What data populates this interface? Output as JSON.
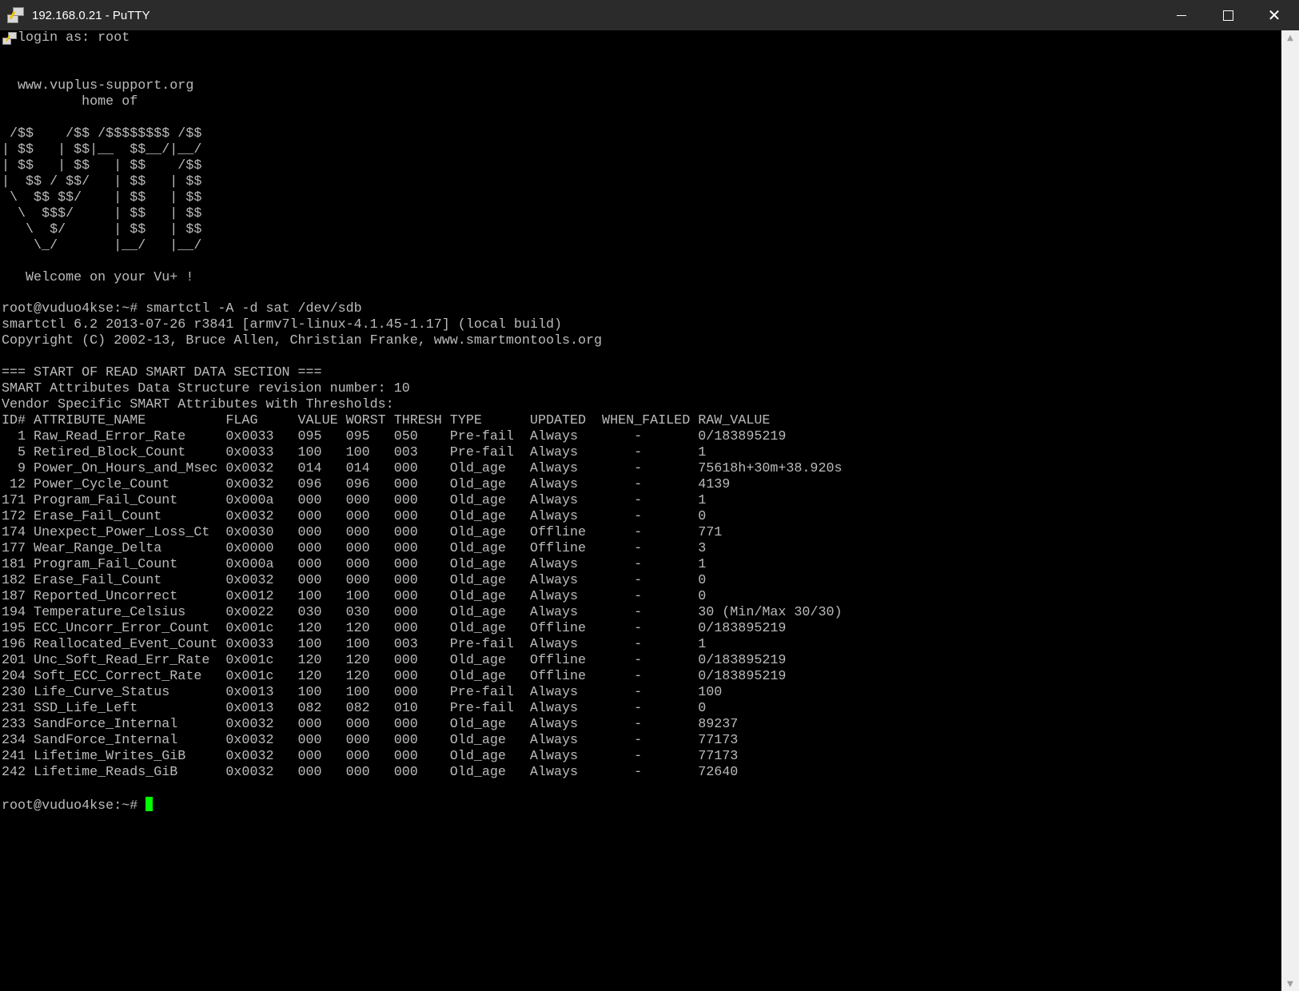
{
  "window": {
    "title": "192.168.0.21 - PuTTY",
    "app_icon": "putty-icon",
    "controls": {
      "minimize_icon": "minimize-icon",
      "maximize_icon": "maximize-icon",
      "close_label": "✕"
    }
  },
  "terminal": {
    "lines": [
      "  login as: root",
      "",
      "",
      "  www.vuplus-support.org",
      "          home of",
      "",
      " /$$    /$$ /$$$$$$$$ /$$",
      "| $$   | $$|__  $$__/|__/",
      "| $$   | $$   | $$    /$$",
      "|  $$ / $$/   | $$   | $$",
      " \\  $$ $$/    | $$   | $$",
      "  \\  $$$/     | $$   | $$",
      "   \\  $/      | $$   | $$",
      "    \\_/       |__/   |__/",
      "",
      "   Welcome on your Vu+ !",
      "",
      "root@vuduo4kse:~# smartctl -A -d sat /dev/sdb",
      "smartctl 6.2 2013-07-26 r3841 [armv7l-linux-4.1.45-1.17] (local build)",
      "Copyright (C) 2002-13, Bruce Allen, Christian Franke, www.smartmontools.org",
      "",
      "=== START OF READ SMART DATA SECTION ===",
      "SMART Attributes Data Structure revision number: 10",
      "Vendor Specific SMART Attributes with Thresholds:",
      "ID# ATTRIBUTE_NAME          FLAG     VALUE WORST THRESH TYPE      UPDATED  WHEN_FAILED RAW_VALUE",
      "  1 Raw_Read_Error_Rate     0x0033   095   095   050    Pre-fail  Always       -       0/183895219",
      "  5 Retired_Block_Count     0x0033   100   100   003    Pre-fail  Always       -       1",
      "  9 Power_On_Hours_and_Msec 0x0032   014   014   000    Old_age   Always       -       75618h+30m+38.920s",
      " 12 Power_Cycle_Count       0x0032   096   096   000    Old_age   Always       -       4139",
      "171 Program_Fail_Count      0x000a   000   000   000    Old_age   Always       -       1",
      "172 Erase_Fail_Count        0x0032   000   000   000    Old_age   Always       -       0",
      "174 Unexpect_Power_Loss_Ct  0x0030   000   000   000    Old_age   Offline      -       771",
      "177 Wear_Range_Delta        0x0000   000   000   000    Old_age   Offline      -       3",
      "181 Program_Fail_Count      0x000a   000   000   000    Old_age   Always       -       1",
      "182 Erase_Fail_Count        0x0032   000   000   000    Old_age   Always       -       0",
      "187 Reported_Uncorrect      0x0012   100   100   000    Old_age   Always       -       0",
      "194 Temperature_Celsius     0x0022   030   030   000    Old_age   Always       -       30 (Min/Max 30/30)",
      "195 ECC_Uncorr_Error_Count  0x001c   120   120   000    Old_age   Offline      -       0/183895219",
      "196 Reallocated_Event_Count 0x0033   100   100   003    Pre-fail  Always       -       1",
      "201 Unc_Soft_Read_Err_Rate  0x001c   120   120   000    Old_age   Offline      -       0/183895219",
      "204 Soft_ECC_Correct_Rate   0x001c   120   120   000    Old_age   Offline      -       0/183895219",
      "230 Life_Curve_Status       0x0013   100   100   000    Pre-fail  Always       -       100",
      "231 SSD_Life_Left           0x0013   082   082   010    Pre-fail  Always       -       0",
      "233 SandForce_Internal      0x0032   000   000   000    Old_age   Always       -       89237",
      "234 SandForce_Internal      0x0032   000   000   000    Old_age   Always       -       77173",
      "241 Lifetime_Writes_GiB     0x0032   000   000   000    Old_age   Always       -       77173",
      "242 Lifetime_Reads_GiB      0x0032   000   000   000    Old_age   Always       -       72640",
      ""
    ],
    "prompt": "root@vuduo4kse:~# ",
    "text_color": "#bbbbbb",
    "cursor_color": "#00ff00",
    "background_color": "#000000"
  }
}
